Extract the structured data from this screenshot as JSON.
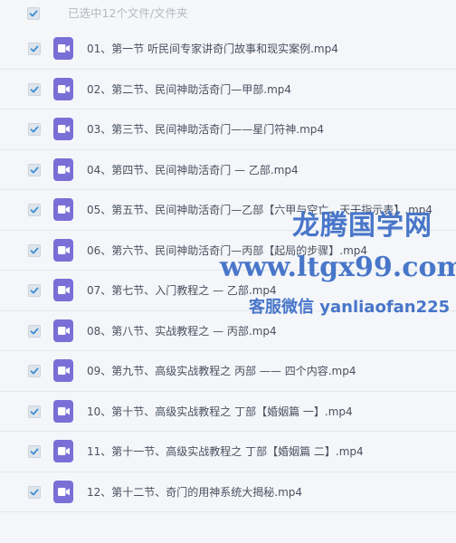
{
  "header": {
    "selected_text": "已选中12个文件/文件夹"
  },
  "files": [
    {
      "name": "01、第一节 听民间专家讲奇门故事和现实案例.mp4"
    },
    {
      "name": "02、第二节、民间神助活奇门—甲部.mp4"
    },
    {
      "name": "03、第三节、民间神助活奇门——星门符神.mp4"
    },
    {
      "name": "04、第四节、民间神助活奇门 — 乙部.mp4"
    },
    {
      "name": "05、第五节、民间神助活奇门—乙部【六甲与空亡、天干指示表】.mp4"
    },
    {
      "name": "06、第六节、民间神助活奇门—丙部【起局的步骤】.mp4"
    },
    {
      "name": "07、第七节、入门教程之 — 乙部.mp4"
    },
    {
      "name": "08、第八节、实战教程之 — 丙部.mp4"
    },
    {
      "name": "09、第九节、高级实战教程之 丙部 —— 四个内容.mp4"
    },
    {
      "name": "10、第十节、高级实战教程之 丁部【婚姻篇 一】.mp4"
    },
    {
      "name": "11、第十一节、高级实战教程之 丁部【婚姻篇 二】.mp4"
    },
    {
      "name": "12、第十二节、奇门的用神系统大揭秘.mp4"
    }
  ],
  "watermark": {
    "title": "龙腾国学网",
    "site": "www.ltgx99.com",
    "contact": "客服微信 yanliaofan225"
  },
  "colors": {
    "checkbox_tick": "#3d8fd6",
    "file_icon": "#7a6fd6",
    "watermark": "#4876c9"
  },
  "icons": {
    "checkbox": "check-icon",
    "file": "video-file-icon"
  }
}
